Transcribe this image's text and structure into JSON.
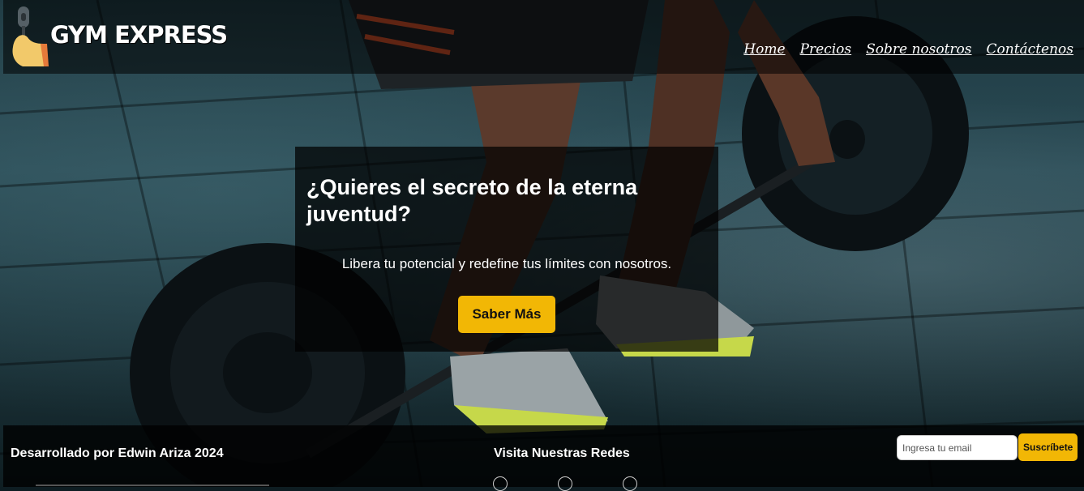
{
  "header": {
    "brand": "GYM EXPRESS",
    "nav": [
      "Home",
      "Precios",
      "Sobre nosotros",
      "Contáctenos"
    ]
  },
  "hero": {
    "title": "¿Quieres el secreto de la eterna juventud?",
    "subtitle": "Libera tu potencial y redefine tus límites con nosotros.",
    "cta_label": "Saber Más"
  },
  "footer": {
    "credit": "Desarrollado por Edwin Ariza 2024",
    "social_title": "Visita Nuestras Redes",
    "social_icons": [
      "facebook-icon",
      "instagram-icon",
      "tiktok-icon"
    ],
    "newsletter": {
      "placeholder": "Ingresa tu email",
      "button_label": "Suscríbete"
    }
  },
  "colors": {
    "accent": "#f2b705",
    "header_bg": "rgba(0,0,0,0.55)",
    "card_bg": "rgba(0,0,0,0.72)"
  }
}
